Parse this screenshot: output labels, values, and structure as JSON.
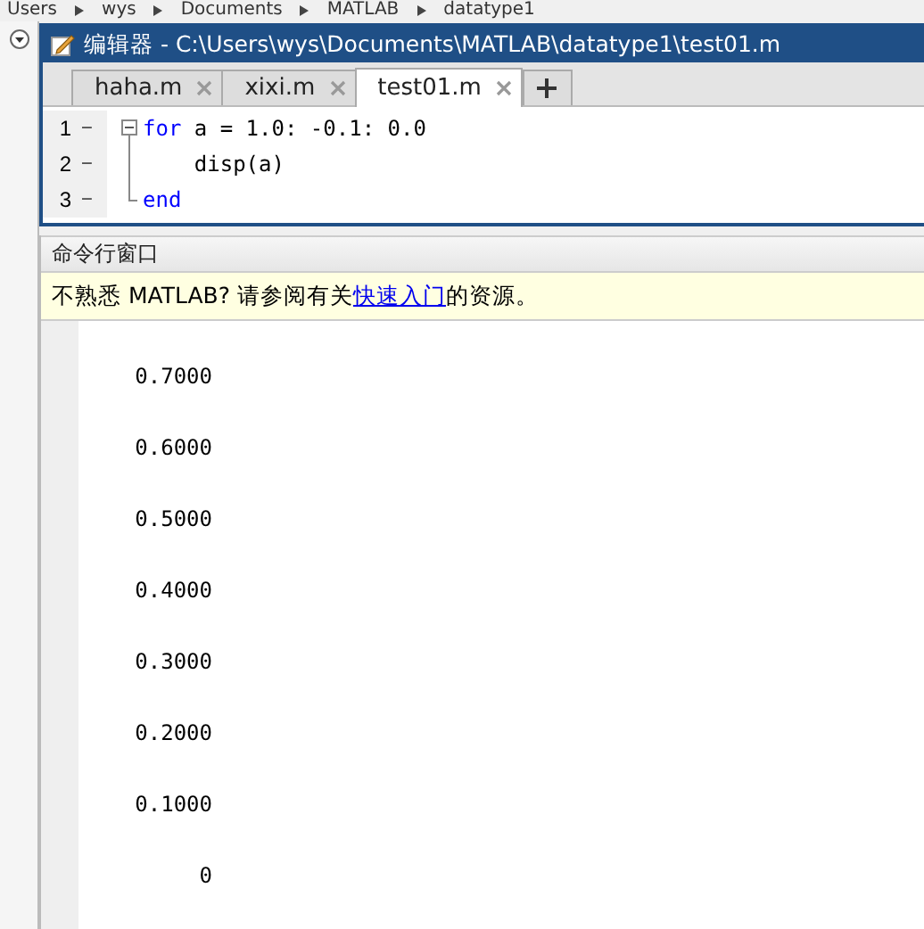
{
  "breadcrumb": [
    "Users",
    "wys",
    "Documents",
    "MATLAB",
    "datatype1"
  ],
  "editor": {
    "title": "编辑器 - C:\\Users\\wys\\Documents\\MATLAB\\datatype1\\test01.m",
    "tabs": [
      {
        "label": "haha.m",
        "selected": false
      },
      {
        "label": "xixi.m",
        "selected": false
      },
      {
        "label": "test01.m",
        "selected": true
      }
    ],
    "lines": [
      {
        "number": "1",
        "marker": "—",
        "tokens": [
          {
            "kind": "keyword",
            "text": "for"
          },
          {
            "kind": "plain",
            "text": " a = 1.0: -0.1: 0.0"
          }
        ]
      },
      {
        "number": "2",
        "marker": "—",
        "tokens": [
          {
            "kind": "plain",
            "text": "    disp(a)"
          }
        ]
      },
      {
        "number": "3",
        "marker": "—",
        "tokens": [
          {
            "kind": "keyword",
            "text": "end"
          }
        ]
      }
    ]
  },
  "command_window": {
    "title": "命令行窗口",
    "notice": {
      "before": "不熟悉 MATLAB? 请参阅有关",
      "link": "快速入门",
      "after": "的资源。"
    },
    "output": [
      "0.7000",
      "0.6000",
      "0.5000",
      "0.4000",
      "0.3000",
      "0.2000",
      "0.1000",
      "0"
    ]
  }
}
